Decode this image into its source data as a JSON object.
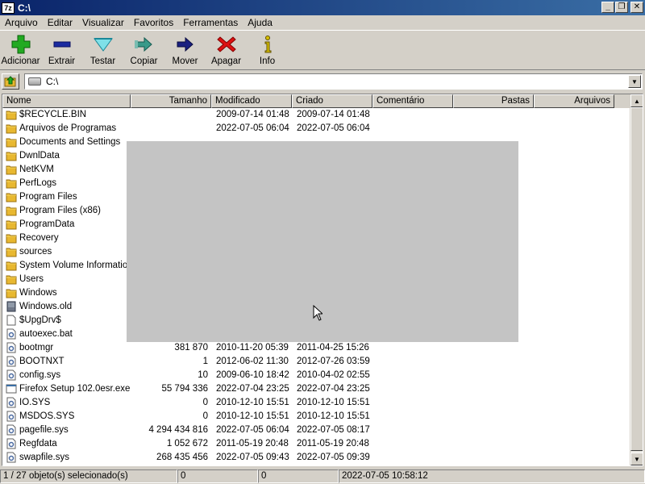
{
  "window": {
    "title": "C:\\",
    "icon_text": "7z"
  },
  "menu": [
    "Arquivo",
    "Editar",
    "Visualizar",
    "Favoritos",
    "Ferramentas",
    "Ajuda"
  ],
  "toolbar": [
    {
      "label": "Adicionar",
      "icon": "plus-icon",
      "color": "#22aa22"
    },
    {
      "label": "Extrair",
      "icon": "minus-icon",
      "color": "#1a2aa0"
    },
    {
      "label": "Testar",
      "icon": "check-icon",
      "color": "#20a8b8"
    },
    {
      "label": "Copiar",
      "icon": "copy-arrow-icon",
      "color": "#2a8a7a"
    },
    {
      "label": "Mover",
      "icon": "move-arrow-icon",
      "color": "#1a2080"
    },
    {
      "label": "Apagar",
      "icon": "delete-x-icon",
      "color": "#dd1111"
    },
    {
      "label": "Info",
      "icon": "info-icon",
      "color": "#b8a000"
    }
  ],
  "address": {
    "value": "C:\\"
  },
  "columns": [
    "Nome",
    "Tamanho",
    "Modificado",
    "Criado",
    "Comentário",
    "Pastas",
    "Arquivos"
  ],
  "files": [
    {
      "name": "$RECYCLE.BIN",
      "size": "",
      "modified": "2009-07-14 01:48",
      "created": "2009-07-14 01:48",
      "type": "folder"
    },
    {
      "name": "Arquivos de Programas",
      "size": "",
      "modified": "2022-07-05 06:04",
      "created": "2022-07-05 06:04",
      "type": "folder"
    },
    {
      "name": "Documents and Settings",
      "size": "",
      "modified": "",
      "created": "",
      "type": "folder"
    },
    {
      "name": "DwnlData",
      "size": "",
      "modified": "",
      "created": "",
      "type": "folder"
    },
    {
      "name": "NetKVM",
      "size": "",
      "modified": "",
      "created": "",
      "type": "folder"
    },
    {
      "name": "PerfLogs",
      "size": "",
      "modified": "",
      "created": "",
      "type": "folder"
    },
    {
      "name": "Program Files",
      "size": "",
      "modified": "",
      "created": "",
      "type": "folder"
    },
    {
      "name": "Program Files (x86)",
      "size": "",
      "modified": "",
      "created": "",
      "type": "folder"
    },
    {
      "name": "ProgramData",
      "size": "",
      "modified": "",
      "created": "",
      "type": "folder"
    },
    {
      "name": "Recovery",
      "size": "",
      "modified": "",
      "created": "",
      "type": "folder"
    },
    {
      "name": "sources",
      "size": "",
      "modified": "",
      "created": "",
      "type": "folder"
    },
    {
      "name": "System Volume Information",
      "size": "",
      "modified": "",
      "created": "",
      "type": "folder"
    },
    {
      "name": "Users",
      "size": "",
      "modified": "",
      "created": "",
      "type": "folder"
    },
    {
      "name": "Windows",
      "size": "",
      "modified": "",
      "created": "",
      "type": "folder"
    },
    {
      "name": "Windows.old",
      "size": "",
      "modified": "",
      "created": "",
      "type": "drive"
    },
    {
      "name": "$UpgDrv$",
      "size": "",
      "modified": "",
      "created": "",
      "type": "file"
    },
    {
      "name": "autoexec.bat",
      "size": "",
      "modified": "",
      "created": "",
      "type": "sys"
    },
    {
      "name": "bootmgr",
      "size": "381 870",
      "modified": "2010-11-20 05:39",
      "created": "2011-04-25 15:26",
      "type": "sys"
    },
    {
      "name": "BOOTNXT",
      "size": "1",
      "modified": "2012-06-02 11:30",
      "created": "2012-07-26 03:59",
      "type": "sys"
    },
    {
      "name": "config.sys",
      "size": "10",
      "modified": "2009-06-10 18:42",
      "created": "2010-04-02 02:55",
      "type": "sys"
    },
    {
      "name": "Firefox Setup 102.0esr.exe",
      "size": "55 794 336",
      "modified": "2022-07-04 23:25",
      "created": "2022-07-04 23:25",
      "type": "exe"
    },
    {
      "name": "IO.SYS",
      "size": "0",
      "modified": "2010-12-10 15:51",
      "created": "2010-12-10 15:51",
      "type": "sys"
    },
    {
      "name": "MSDOS.SYS",
      "size": "0",
      "modified": "2010-12-10 15:51",
      "created": "2010-12-10 15:51",
      "type": "sys"
    },
    {
      "name": "pagefile.sys",
      "size": "4 294 434 816",
      "modified": "2022-07-05 06:04",
      "created": "2022-07-05 08:17",
      "type": "sys"
    },
    {
      "name": "Regfdata",
      "size": "1 052 672",
      "modified": "2011-05-19 20:48",
      "created": "2011-05-19 20:48",
      "type": "sys"
    },
    {
      "name": "swapfile.sys",
      "size": "268 435 456",
      "modified": "2022-07-05 09:43",
      "created": "2022-07-05 09:39",
      "type": "sys"
    }
  ],
  "status": {
    "selection": "1 / 27 objeto(s) selecionado(s)",
    "size": "0",
    "packed": "0",
    "datetime": "2022-07-05 10:58:12"
  },
  "colors": {
    "folder": "#e8b830",
    "titlebar_start": "#0a246a",
    "titlebar_end": "#3a6ea5"
  }
}
